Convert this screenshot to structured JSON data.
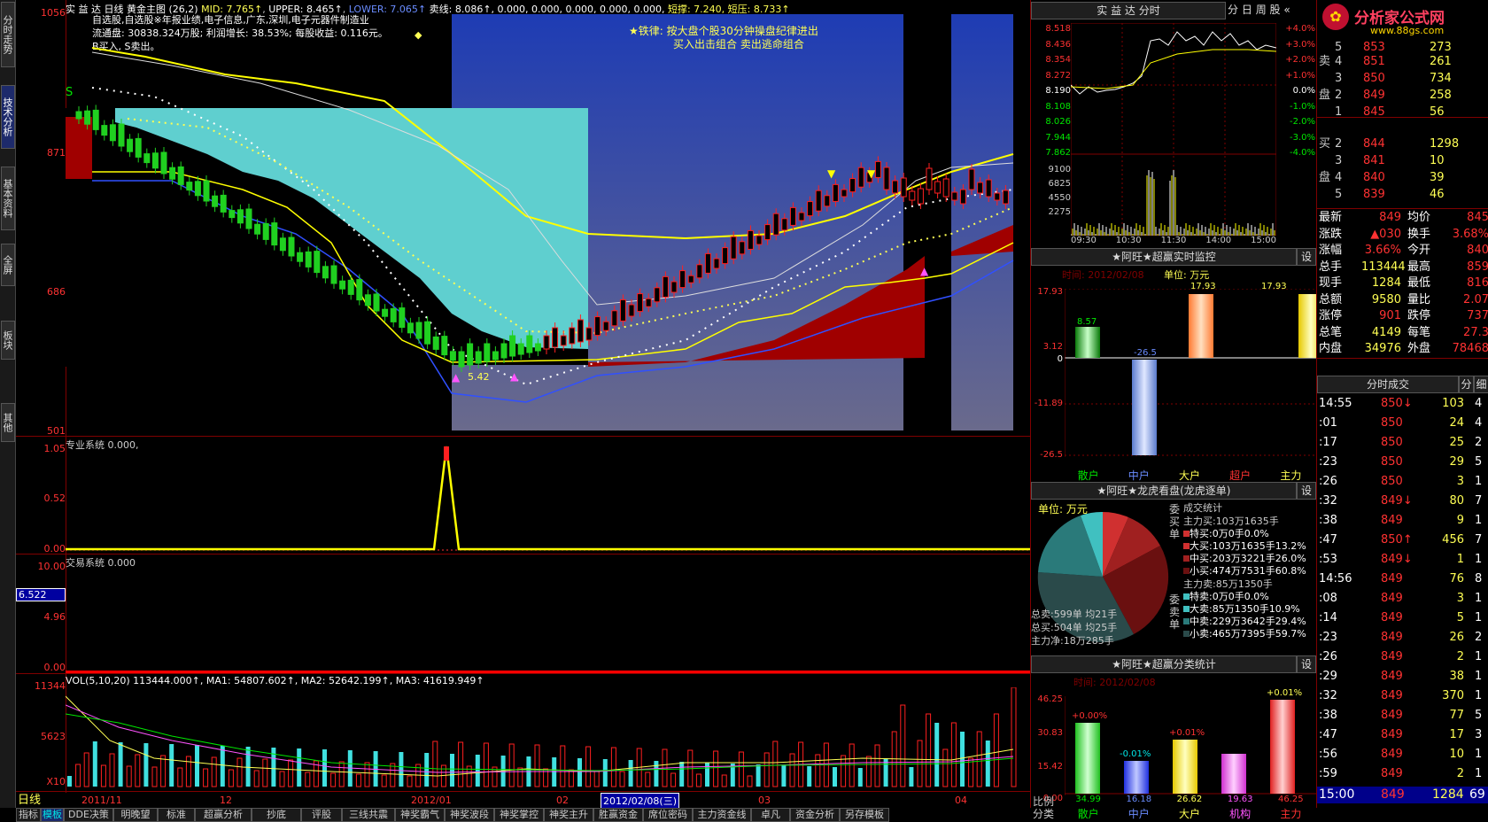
{
  "main_header": {
    "stock": "实 益 达",
    "period": "日线",
    "chart": "黄金主图",
    "params": "(26,2)",
    "mid_label": "MID: 7.765↑",
    "upper_label": "UPPER: 8.465↑",
    "lower_label": "LOWER: 7.065↑",
    "sell_line": "卖线: 8.086↑, 0.000, 0.000, 0.000, 0.000, 0.000,",
    "support": "短撑: 7.240,",
    "resist": "短压: 8.733↑"
  },
  "info_lines": [
    "自选股,自选股※年报业绩,电子信息,广东,深圳,电子元器件制造业",
    "流通盘: 30838.324万股; 利润增长: 38.53%; 每股收益: 0.116元。",
    "B买入, S卖出。"
  ],
  "notice": {
    "line1": "★铁律: 按大盘个股30分钟操盘纪律进出",
    "line2": "买入出击组合      卖出逃命组合"
  },
  "price_axis": [
    "1056",
    "871",
    "686",
    "501"
  ],
  "mark_label": "5.42",
  "pro_panel": {
    "label": "专业系统 0.000,",
    "axis": [
      "1.05",
      "0.52",
      "0.00"
    ]
  },
  "trade_panel": {
    "label": "交易系统 0.000",
    "axis": [
      "10.00",
      "4.96",
      "0.00"
    ],
    "cursor": "6.522"
  },
  "vol_panel": {
    "label": "VOL(5,10,20) 113444.000↑, MA1: 54807.602↑, MA2: 52642.199↑, MA3: 41619.949↑",
    "axis": [
      "11344",
      "5623",
      "X10"
    ]
  },
  "date_axis": [
    "2011/11",
    "12",
    "2012/01",
    "02",
    "2012/02/08(三)",
    "03",
    "04"
  ],
  "period_bar": "日线",
  "left_tabs": [
    "分时走势",
    "技术分析",
    "基本资料",
    "全屏",
    "板块",
    "其他"
  ],
  "bottom_tabs": [
    "指标",
    "模板",
    "DDE决策",
    "明晚望",
    "标准",
    "超赢分析",
    "抄底",
    "评股",
    "三线共震",
    "神奖霸气",
    "神奖波段",
    "神奖掌控",
    "神奖主升",
    "胜赢资金",
    "席位密码",
    "主力资金线",
    "卓凡",
    "资金分析",
    "另存模板"
  ],
  "intraday": {
    "title": "实 益 达 分时",
    "tabs": [
      "分",
      "日",
      "周",
      "股",
      "«"
    ],
    "prices": [
      "8.518",
      "8.436",
      "8.354",
      "8.272",
      "8.190",
      "8.108",
      "8.026",
      "7.944",
      "7.862"
    ],
    "pcts": [
      "+4.0%",
      "+3.0%",
      "+2.0%",
      "+1.0%",
      "0.0%",
      "-1.0%",
      "-2.0%",
      "-3.0%",
      "-4.0%"
    ],
    "vols": [
      "9100",
      "6825",
      "4550",
      "2275"
    ],
    "times": [
      "09:30",
      "10:30",
      "11:30",
      "14:00",
      "15:00"
    ]
  },
  "monitor": {
    "title": "★阿旺★超赢实时监控",
    "set": "设",
    "time": "时间: 2012/02/08",
    "unit": "单位: 万元",
    "axis": [
      "17.93",
      "3.12",
      "0",
      "-11.89",
      "-26.5"
    ],
    "bars": [
      {
        "name": "散户",
        "value": "8.57"
      },
      {
        "name": "中户",
        "value": "-26.5"
      },
      {
        "name": "大户",
        "value": "17.93"
      },
      {
        "name": "超户",
        "value": ""
      },
      {
        "name": "主力",
        "value": "17.93"
      }
    ]
  },
  "dragon": {
    "title": "★阿旺★龙虎看盘(龙虎逐单)",
    "set": "设",
    "unit": "单位: 万元",
    "stats_title": "成交统计",
    "buy_total": "主力买:103万1635手",
    "buy_items": [
      "特买:0万0手0.0%",
      "大买:103万1635手13.2%",
      "中买:203万3221手26.0%",
      "小买:474万7531手60.8%"
    ],
    "sell_total": "主力卖:85万1350手",
    "sell_items": [
      "特卖:0万0手0.0%",
      "大卖:85万1350手10.9%",
      "中卖:229万3642手29.4%",
      "小卖:465万7395手59.7%"
    ],
    "side_buy": "委买单",
    "side_sell": "委卖单",
    "sum_sell": "总卖:599单 均21手",
    "sum_buy": "总买:504单 均25手",
    "net": "主力净:18万285手"
  },
  "classify": {
    "title": "★阿旺★超赢分类统计",
    "set": "设",
    "time": "时间: 2012/02/08",
    "axis": [
      "46.25",
      "30.83",
      "15.42",
      "0.00"
    ],
    "side": "比例分类",
    "bars": [
      {
        "name": "散户",
        "pct": "+0.00%",
        "value": "34.99"
      },
      {
        "name": "中户",
        "pct": "-0.01%",
        "value": "16.18"
      },
      {
        "name": "大户",
        "pct": "+0.01%",
        "value": "26.62"
      },
      {
        "name": "机构",
        "pct": "",
        "value": "19.63"
      },
      {
        "name": "主力",
        "pct": "+0.01%",
        "value": "46.25"
      }
    ]
  },
  "orderbook": {
    "sell": [
      {
        "label": "卖",
        "n": "4",
        "p": "851",
        "v": "261"
      },
      {
        "label": "",
        "n": "3",
        "p": "850",
        "v": "734"
      },
      {
        "label": "盘",
        "n": "2",
        "p": "849",
        "v": "258"
      },
      {
        "label": "",
        "n": "1",
        "p": "845",
        "v": "56"
      }
    ],
    "buy": [
      {
        "label": "买",
        "n": "2",
        "p": "844",
        "v": "1298"
      },
      {
        "label": "",
        "n": "3",
        "p": "841",
        "v": "10"
      },
      {
        "label": "盘",
        "n": "4",
        "p": "840",
        "v": "39"
      },
      {
        "label": "",
        "n": "5",
        "p": "839",
        "v": "46"
      }
    ],
    "top": {
      "n": "5",
      "p": "853",
      "v": "273"
    }
  },
  "stats": [
    {
      "k1": "最新",
      "v1": "849",
      "k2": "均价",
      "v2": "845"
    },
    {
      "k1": "涨跌",
      "v1": "▲030",
      "k2": "换手",
      "v2": "3.68%"
    },
    {
      "k1": "涨幅",
      "v1": "3.66%",
      "k2": "今开",
      "v2": "840"
    },
    {
      "k1": "总手",
      "v1": "113444",
      "k2": "最高",
      "v2": "859"
    },
    {
      "k1": "现手",
      "v1": "1284",
      "k2": "最低",
      "v2": "816"
    },
    {
      "k1": "总额",
      "v1": "9580",
      "k2": "量比",
      "v2": "2.07"
    },
    {
      "k1": "涨停",
      "v1": "901",
      "k2": "跌停",
      "v2": "737"
    },
    {
      "k1": "总笔",
      "v1": "4149",
      "k2": "每笔",
      "v2": "27.3"
    },
    {
      "k1": "内盘",
      "v1": "34976",
      "k2": "外盘",
      "v2": "78468"
    }
  ],
  "ticks": {
    "title": "分时成交",
    "tabs": [
      "分",
      "细"
    ],
    "rows": [
      [
        "14:55",
        "850↓",
        "103",
        "4"
      ],
      [
        ":01",
        "850",
        "24",
        "4"
      ],
      [
        ":17",
        "850",
        "25",
        "2"
      ],
      [
        ":23",
        "850",
        "29",
        "5"
      ],
      [
        ":26",
        "850",
        "3",
        "1"
      ],
      [
        ":32",
        "849↓",
        "80",
        "7"
      ],
      [
        ":38",
        "849",
        "9",
        "1"
      ],
      [
        ":47",
        "850↑",
        "456",
        "7"
      ],
      [
        ":53",
        "849↓",
        "1",
        "1"
      ],
      [
        "14:56",
        "849",
        "76",
        "8"
      ],
      [
        ":08",
        "849",
        "3",
        "1"
      ],
      [
        ":14",
        "849",
        "5",
        "1"
      ],
      [
        ":23",
        "849",
        "26",
        "2"
      ],
      [
        ":26",
        "849",
        "2",
        "1"
      ],
      [
        ":29",
        "849",
        "38",
        "1"
      ],
      [
        ":32",
        "849",
        "370",
        "1"
      ],
      [
        ":38",
        "849",
        "77",
        "5"
      ],
      [
        ":47",
        "849",
        "17",
        "3"
      ],
      [
        ":56",
        "849",
        "10",
        "1"
      ],
      [
        ":59",
        "849",
        "2",
        "1"
      ]
    ],
    "last": [
      "15:00",
      "849",
      "1284",
      "69"
    ]
  },
  "logo": {
    "text": "分析家公式网",
    "url": "www.88gs.com"
  }
}
